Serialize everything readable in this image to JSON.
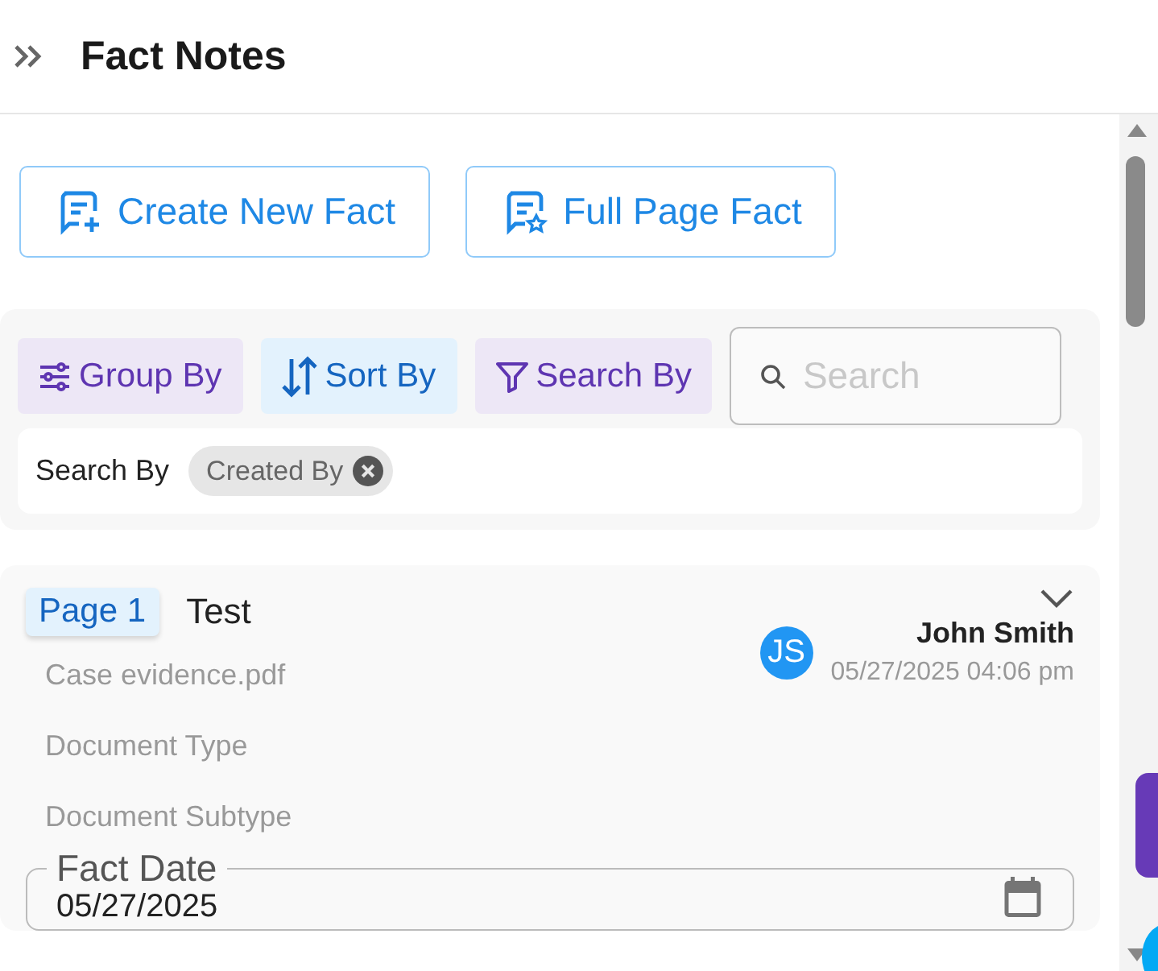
{
  "header": {
    "title": "Fact Notes"
  },
  "actions": [
    {
      "label": "Create New Fact",
      "kind": "create"
    },
    {
      "label": "Full Page Fact",
      "kind": "full"
    }
  ],
  "filters": {
    "buttons": [
      {
        "label": "Group By",
        "kind": "group",
        "selected": false
      },
      {
        "label": "Sort By",
        "kind": "sort",
        "selected": true
      },
      {
        "label": "Search By",
        "kind": "search",
        "selected": false
      }
    ],
    "search": {
      "placeholder": "Search"
    },
    "active_label": "Search By",
    "chips": [
      {
        "label": "Created By"
      }
    ]
  },
  "fact": {
    "page": "Page 1",
    "title": "Test",
    "expanded": false,
    "file": "Case evidence.pdf",
    "document_type": "Document Type",
    "document_subtype": "Document Subtype",
    "author": {
      "initials": "JS",
      "name": "John Smith",
      "time": "05/27/2025 04:06 pm"
    },
    "date_field": {
      "label": "Fact Date",
      "value": "05/27/2025"
    }
  }
}
